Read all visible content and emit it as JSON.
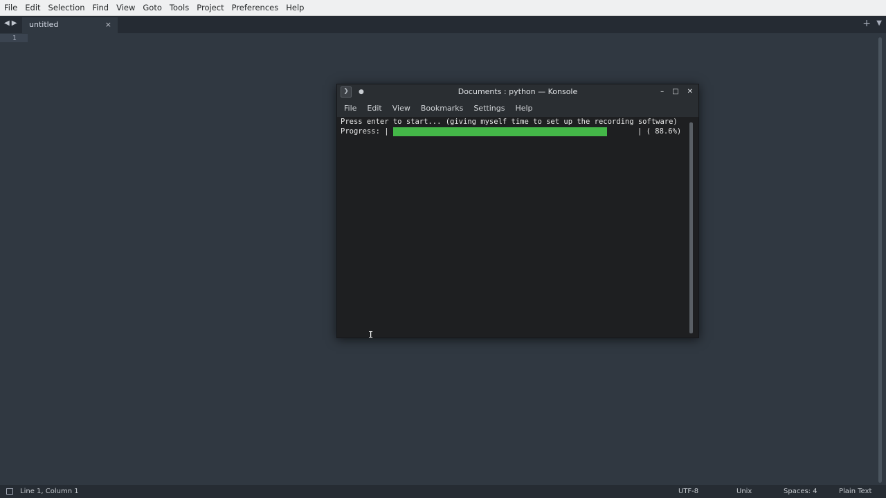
{
  "menubar": {
    "items": [
      "File",
      "Edit",
      "Selection",
      "Find",
      "View",
      "Goto",
      "Tools",
      "Project",
      "Preferences",
      "Help"
    ]
  },
  "tabs": {
    "active_label": "untitled",
    "close_glyph": "×",
    "new_tab_glyph": "+",
    "list_glyph": "▼",
    "back_glyph": "◀",
    "forward_glyph": "▶"
  },
  "editor": {
    "line_number": "1"
  },
  "statusbar": {
    "position": "Line 1, Column 1",
    "encoding": "UTF-8",
    "line_endings": "Unix",
    "indent": "Spaces: 4",
    "syntax": "Plain Text"
  },
  "konsole": {
    "title": "Documents : python — Konsole",
    "pin_glyph": "●",
    "minimize_glyph": "–",
    "maximize_glyph": "□",
    "close_glyph": "✕",
    "menu": [
      "File",
      "Edit",
      "View",
      "Bookmarks",
      "Settings",
      "Help"
    ],
    "terminal": {
      "line1": "Press enter to start... (giving myself time to set up the recording software)",
      "progress_label": "Progress: |",
      "progress_end": "| ( 88.6%)",
      "progress_fraction": 0.886,
      "progress_color": "#44b748"
    }
  },
  "colors": {
    "editor_bg": "#303841",
    "menubar_bg": "#eff0f1",
    "terminal_bg": "#1e1f21"
  },
  "icons": {
    "konsole_app": "terminal-prompt-icon",
    "mouse_cursor": "i-beam-cursor-icon"
  }
}
